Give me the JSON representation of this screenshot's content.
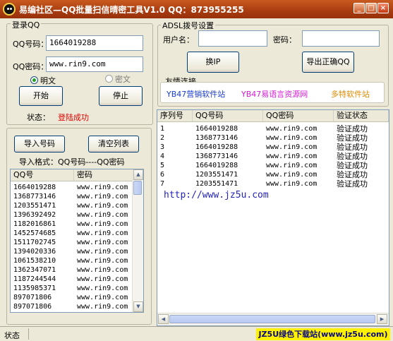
{
  "window": {
    "title": "易编社区—QQ批量扫信晴密工具V1.0   QQ：873955255",
    "minimize_glyph": "_",
    "maximize_glyph": "□",
    "close_glyph": "×"
  },
  "login": {
    "group_title": "登录QQ",
    "qq_label": "QQ号码：",
    "qq_value": "1664019288",
    "pwd_label": "QQ密码：",
    "pwd_value": "www.rin9.com",
    "radio_plain": "明文",
    "radio_cipher": "密文",
    "start_button": "开始",
    "stop_button": "停止",
    "status_label": "状态：",
    "status_value": "登陆成功",
    "status_color": "#e00000"
  },
  "dialup": {
    "group_title": "ADSL拨号设置",
    "user_label": "用户名：",
    "user_value": "",
    "pwd_label": "密码：",
    "pwd_value": "",
    "change_ip_button": "换IP",
    "export_button": "导出正确QQ"
  },
  "links": {
    "title": "友情连接",
    "items": [
      {
        "label": "YB47营销软件站",
        "color": "#1a3ccf"
      },
      {
        "label": "YB47易语言资源网",
        "color": "#d81ad8"
      },
      {
        "label": "多特软件站",
        "color": "#e08a00"
      }
    ]
  },
  "import": {
    "import_button": "导入号码",
    "clear_button": "清空列表",
    "format_hint": "导入格式：QQ号码----QQ密码",
    "columns": [
      "QQ号",
      "密码"
    ],
    "rows": [
      [
        "1664019288",
        "www.rin9.com"
      ],
      [
        "1368773146",
        "www.rin9.com"
      ],
      [
        "1203551471",
        "www.rin9.com"
      ],
      [
        "1396392492",
        "www.rin9.com"
      ],
      [
        "1182016861",
        "www.rin9.com"
      ],
      [
        "1452574685",
        "www.rin9.com"
      ],
      [
        "1511702745",
        "www.rin9.com"
      ],
      [
        "1394020336",
        "www.rin9.com"
      ],
      [
        "1061538210",
        "www.rin9.com"
      ],
      [
        "1362347071",
        "www.rin9.com"
      ],
      [
        "1187244544",
        "www.rin9.com"
      ],
      [
        "1135985371",
        "www.rin9.com"
      ],
      [
        "897071806",
        "www.rin9.com"
      ],
      [
        "897071806",
        "www.rin9.com"
      ]
    ]
  },
  "results": {
    "columns": [
      "序列号",
      "QQ号码",
      "QQ密码",
      "验证状态"
    ],
    "rows": [
      [
        "1",
        "1664019288",
        "www.rin9.com",
        "验证成功"
      ],
      [
        "2",
        "1368773146",
        "www.rin9.com",
        "验证成功"
      ],
      [
        "3",
        "1664019288",
        "www.rin9.com",
        "验证成功"
      ],
      [
        "4",
        "1368773146",
        "www.rin9.com",
        "验证成功"
      ],
      [
        "5",
        "1664019288",
        "www.rin9.com",
        "验证成功"
      ],
      [
        "6",
        "1203551471",
        "www.rin9.com",
        "验证成功"
      ],
      [
        "7",
        "1203551471",
        "www.rin9.com",
        "验证成功"
      ]
    ],
    "watermark": "http://www.jz5u.com",
    "watermark_color": "#2323b8"
  },
  "statusbar": {
    "label": "状态",
    "brand": "JZ5U绿色下载站(www.jz5u.com)",
    "brand_color": "#0a0a80",
    "brand_bg": "#fff100"
  },
  "scroll_glyphs": {
    "up": "▲",
    "down": "▼",
    "left": "◀",
    "right": "▶"
  }
}
